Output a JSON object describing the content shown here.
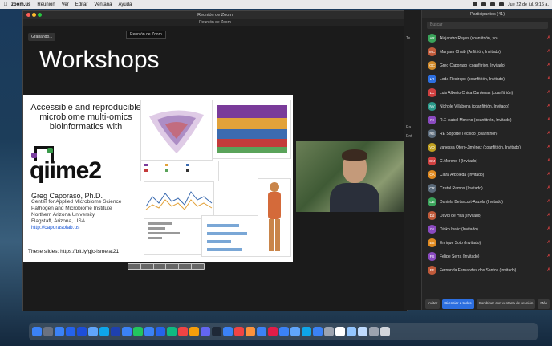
{
  "menubar": {
    "app_name": "zoom.us",
    "items": [
      "Reunión",
      "Ver",
      "Editar",
      "Ventana",
      "Ayuda"
    ],
    "clock": "Jue 22 de jul. 9:16 a."
  },
  "zoom_window": {
    "title": "Reunión de Zoom",
    "subtitle": "Reunión de Zoom",
    "recording": "Grabando...",
    "view_chip": "Reunión de Zoom",
    "overlay_title": "Workshops"
  },
  "slide": {
    "title": "Accessible and reproducible microbiome multi-omics bioinformatics with",
    "logo_text": "qiime2",
    "author": "Greg Caporaso, Ph.D.",
    "affiliation_lines": [
      "Center for Applied Microbiome Science",
      "Pathogen and Microbiome Institute",
      "Northern Arizona University",
      "Flagstaff, Arizona, USA"
    ],
    "link": "http://caporasolab.us",
    "slides_url": "These slides: https://bit.ly/gjc-ismelat21"
  },
  "chat_side": {
    "lines": [
      "Te",
      "Pa",
      "Ent"
    ]
  },
  "participants": {
    "title": "Participantes (41)",
    "search_placeholder": "Buscar",
    "items": [
      {
        "initials": "AR",
        "name": "Alejandro Reyes (coanfitrión, yo)",
        "color": "#3aa35a"
      },
      {
        "initials": "MC",
        "name": "Maryam Chaib (Anfitrión, Invitado)",
        "color": "#c05a3a"
      },
      {
        "initials": "GC",
        "name": "Greg Caporaso (coanfitrión, Invitado)",
        "color": "#d08a2a"
      },
      {
        "initials": "LR",
        "name": "Leda Restrepo (coanfitrión, Invitado)",
        "color": "#2d6fe0"
      },
      {
        "initials": "LC",
        "name": "Luis Alberto Chica Cardenas (coanfitrión)",
        "color": "#d04040"
      },
      {
        "initials": "NV",
        "name": "Nichole Villabona (coanfitrión, Invitado)",
        "color": "#2a9a8a"
      },
      {
        "initials": "RI",
        "name": "R.E Isabel Moreno (coanfitrión, Invitado)",
        "color": "#8a4ac0"
      },
      {
        "initials": "RS",
        "name": "RE Soporte Técnico (coanfitrión)",
        "color": "#5a6a7a"
      },
      {
        "initials": "VO",
        "name": "vanessa Otero-Jiménez (coanfitrión, Invitado)",
        "color": "#c0a020"
      },
      {
        "initials": "CM",
        "name": "C.Moreno-I (Invitado)",
        "color": "#d04040"
      },
      {
        "initials": "CA",
        "name": "Clara Arboleda (Invitado)",
        "color": "#e08a20"
      },
      {
        "initials": "CR",
        "name": "Cristal Ramos (Invitado)",
        "color": "#5a6a7a"
      },
      {
        "initials": "DB",
        "name": "Daniela Betancurt-Anzola (Invitado)",
        "color": "#3aa35a"
      },
      {
        "initials": "Dd",
        "name": "David de Hita (Invitado)",
        "color": "#c05a3a"
      },
      {
        "initials": "DI",
        "name": "Dinko Ivalic (Invitado)",
        "color": "#8a4ac0"
      },
      {
        "initials": "ES",
        "name": "Enrique Soto (Invitado)",
        "color": "#e08a20"
      },
      {
        "initials": "FS",
        "name": "Felipe Serra (Invitado)",
        "color": "#8a4ac0"
      },
      {
        "initials": "FF",
        "name": "Fernanda Fernandes dos Santos (Invitado)",
        "color": "#c05a3a"
      }
    ],
    "buttons": [
      "Invitar",
      "Silenciar a todos",
      "Combinar con ventana de reunión",
      "Más"
    ]
  }
}
